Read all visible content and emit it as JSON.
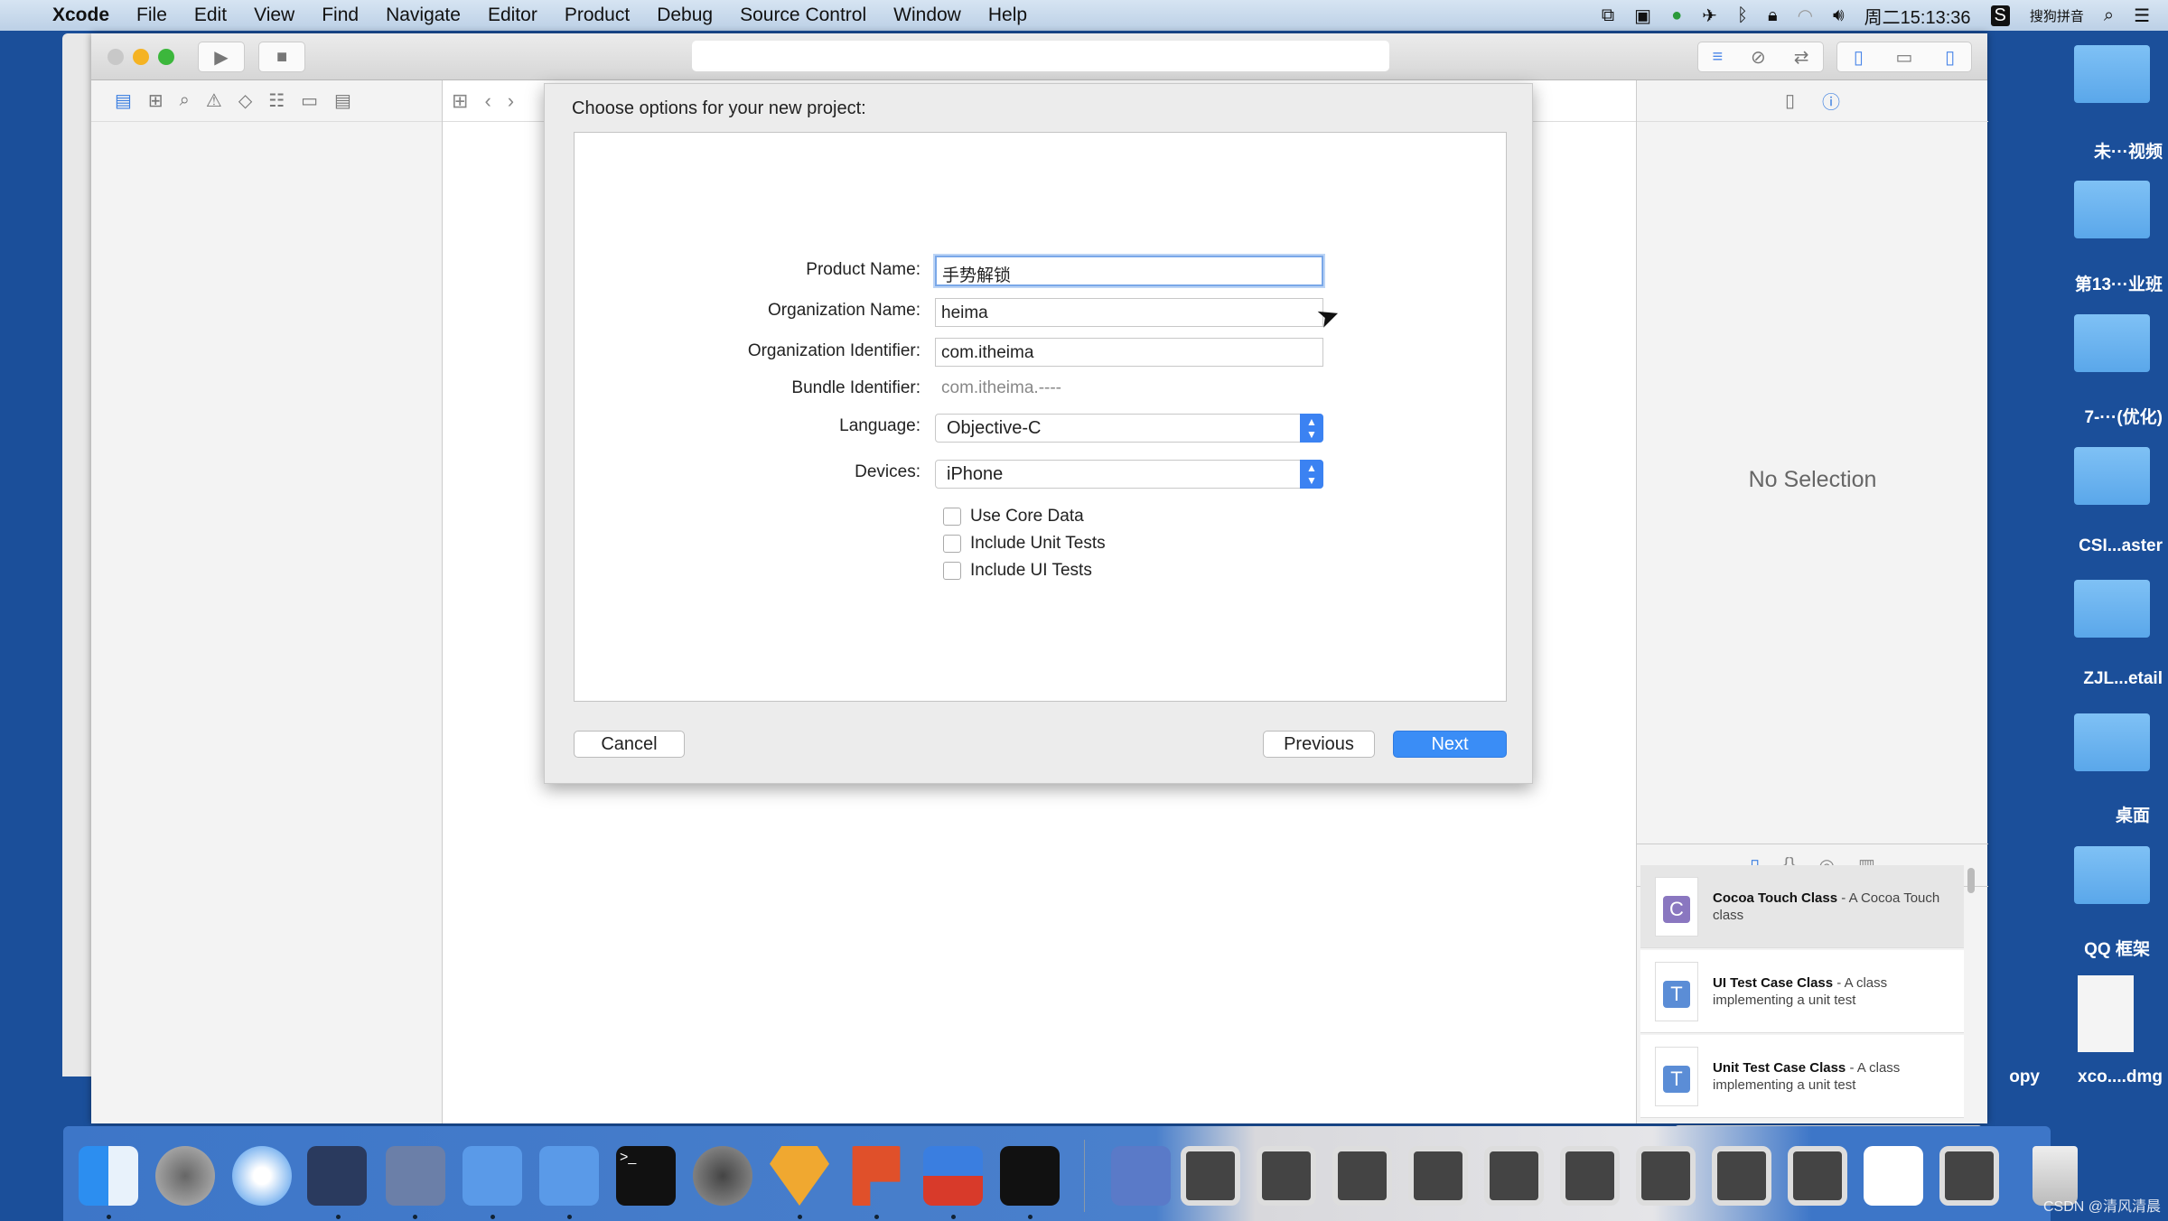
{
  "menubar": {
    "apple": "",
    "app": "Xcode",
    "items": [
      "File",
      "Edit",
      "View",
      "Find",
      "Navigate",
      "Editor",
      "Product",
      "Debug",
      "Source Control",
      "Window",
      "Help"
    ],
    "clock": "周二15:13:36",
    "ime": "搜狗拼音"
  },
  "dialog": {
    "title": "Choose options for your new project:",
    "product_name_label": "Product Name:",
    "product_name": "手势解锁",
    "org_name_label": "Organization Name:",
    "org_name": "heima",
    "org_id_label": "Organization Identifier:",
    "org_id": "com.itheima",
    "bundle_label": "Bundle Identifier:",
    "bundle": "com.itheima.----",
    "language_label": "Language:",
    "language": "Objective-C",
    "devices_label": "Devices:",
    "devices": "iPhone",
    "checkboxes": [
      {
        "label": "Use Core Data",
        "checked": false
      },
      {
        "label": "Include Unit Tests",
        "checked": false
      },
      {
        "label": "Include UI Tests",
        "checked": false
      }
    ],
    "cancel": "Cancel",
    "previous": "Previous",
    "next": "Next"
  },
  "inspector": {
    "empty": "No Selection"
  },
  "library": {
    "items": [
      {
        "letter": "C",
        "color": "#8a77c0",
        "name": "Cocoa Touch Class",
        "desc": " - A Cocoa Touch class"
      },
      {
        "letter": "T",
        "color": "#5b8dd6",
        "name": "UI Test Case Class",
        "desc": " - A class implementing a unit test"
      },
      {
        "letter": "T",
        "color": "#5b8dd6",
        "name": "Unit Test Case Class",
        "desc": " - A class implementing a unit test"
      }
    ]
  },
  "desktop": {
    "items": [
      "未···视频",
      "第13···业班",
      "7-···(优化)",
      "CSI...aster",
      "ZJL...etail",
      "桌面",
      "QQ 框架",
      "xco....dmg"
    ],
    "partial": "opy"
  },
  "watermark": "CSDN @清风清晨"
}
